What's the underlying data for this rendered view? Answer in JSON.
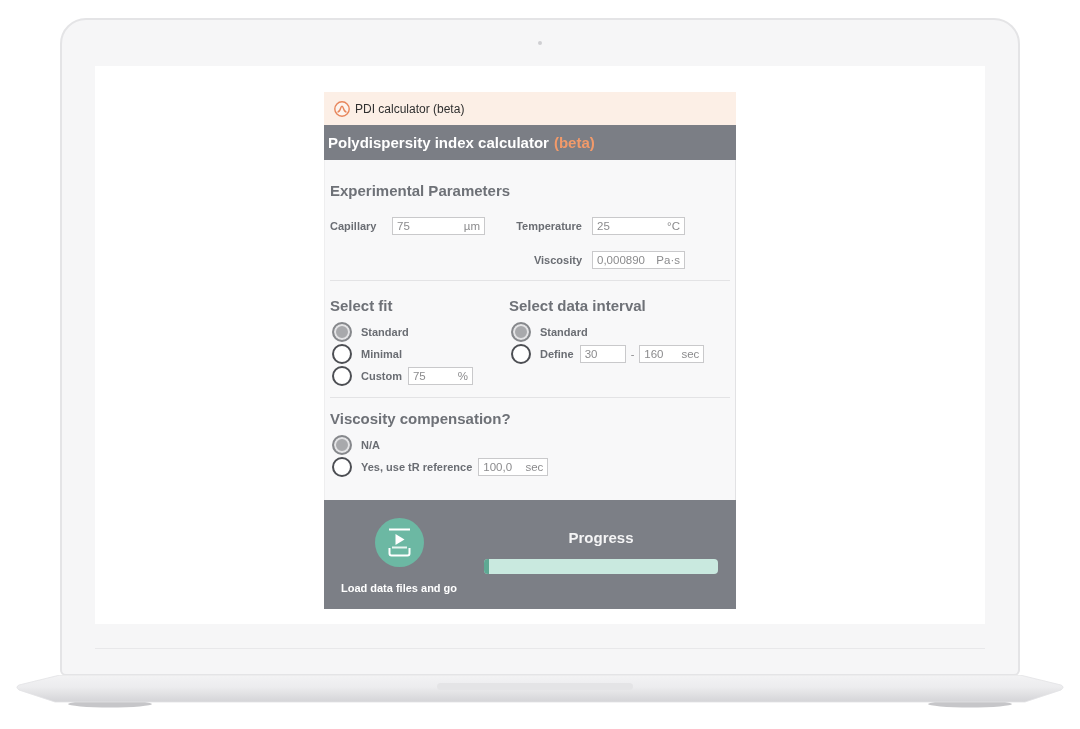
{
  "window": {
    "title": "PDI calculator (beta)"
  },
  "header": {
    "title": "Polydispersity index calculator",
    "tag": "(beta)"
  },
  "experimental_parameters": {
    "heading": "Experimental Parameters",
    "fields": [
      {
        "label": "Capillary",
        "value": "75",
        "unit": "µm"
      },
      {
        "label": "Temperature",
        "value": "25",
        "unit": "°C"
      },
      {
        "label": "Viscosity",
        "value": "0,000890",
        "unit": "Pa·s"
      }
    ]
  },
  "select_fit": {
    "heading": "Select fit",
    "options": [
      {
        "label": "Standard",
        "selected": true
      },
      {
        "label": "Minimal",
        "selected": false
      },
      {
        "label": "Custom",
        "selected": false,
        "field": {
          "value": "75",
          "unit": "%"
        }
      }
    ]
  },
  "select_data_interval": {
    "heading": "Select data interval",
    "options": [
      {
        "label": "Standard",
        "selected": true
      },
      {
        "label": "Define",
        "selected": false,
        "range": {
          "from": "30",
          "separator": "-",
          "to": "160",
          "unit": "sec"
        }
      }
    ]
  },
  "viscosity_compensation": {
    "heading": "Viscosity compensation?",
    "options": [
      {
        "label": "N/A",
        "selected": true
      },
      {
        "label": "Yes, use tR reference",
        "selected": false,
        "field": {
          "value": "100,0",
          "unit": "sec"
        }
      }
    ]
  },
  "footer": {
    "load_button": {
      "label": "Load data files and go"
    },
    "progress": {
      "label": "Progress",
      "level": 0.02
    }
  }
}
